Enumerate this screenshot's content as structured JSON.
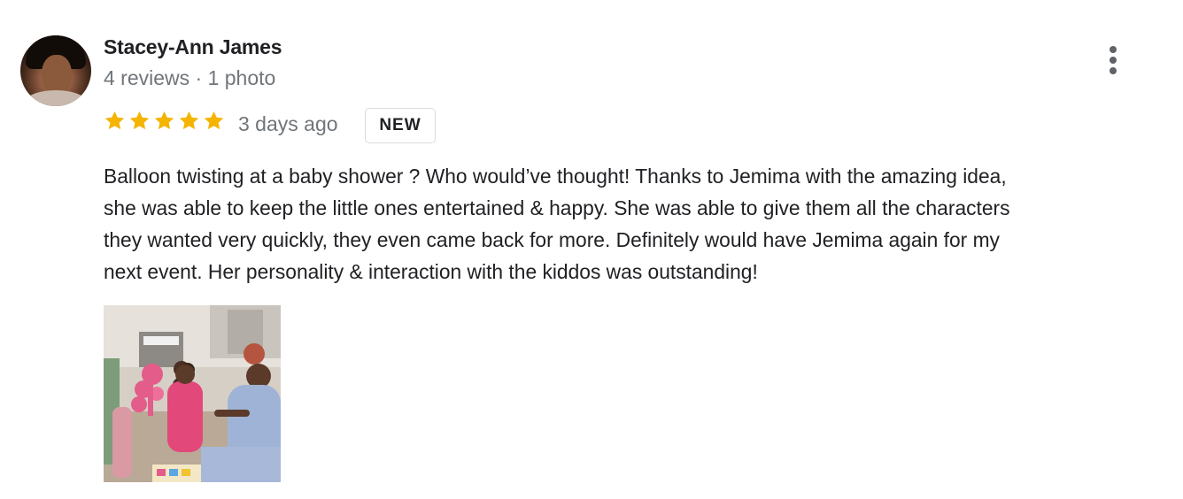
{
  "reviewer": {
    "name": "Stacey-Ann James",
    "meta": "4 reviews · 1 photo"
  },
  "rating": {
    "stars": 5,
    "max": 5,
    "star_color": "#f4b400",
    "time": "3 days ago",
    "badge": "NEW"
  },
  "review": {
    "text": "Balloon twisting at a baby shower ? Who would’ve thought!  Thanks to Jemima with the amazing idea,\nshe was able to keep the little ones entertained & happy. She was able to give them all the characters\nthey wanted very quickly, they even came back for more.  Definitely would have Jemima again for my\nnext event. Her personality & interaction with the kiddos was outstanding!"
  },
  "icons": {
    "menu": "more-vert-icon",
    "star": "star-icon"
  }
}
